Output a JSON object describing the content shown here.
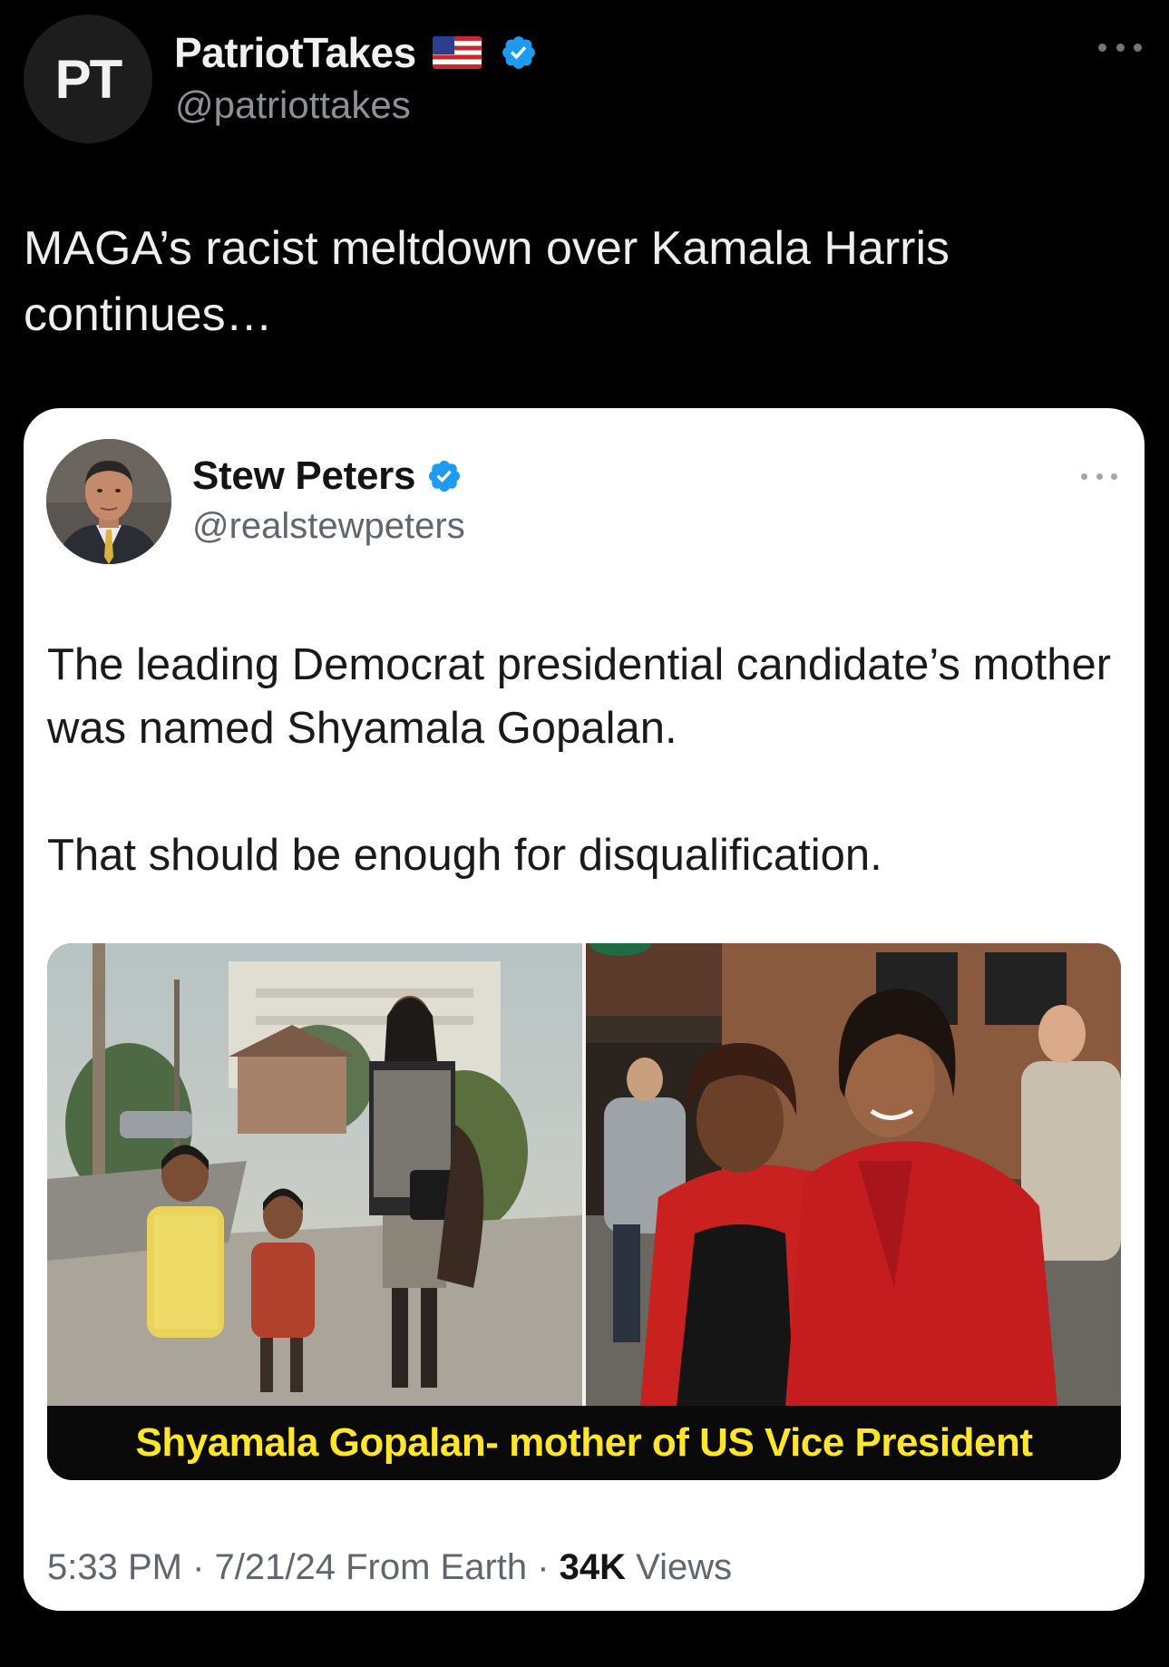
{
  "outer_tweet": {
    "avatar_initials": "PT",
    "author_name": "PatriotTakes",
    "author_handle": "@patriottakes",
    "flag_icon": "us-flag-icon",
    "verified_icon": "verified-badge-icon",
    "body": "MAGA’s racist meltdown over Kamala Harris continues…"
  },
  "quoted_tweet": {
    "author_name": "Stew Peters",
    "author_handle": "@realstewpeters",
    "verified_icon": "verified-badge-icon",
    "paragraph_1": "The leading Democrat presidential candidate’s mother was named Shyamala Gopalan.",
    "paragraph_2": "That should be enough for disqualification.",
    "media_caption": "Shyamala Gopalan- mother of US Vice President",
    "timestamp": "5:33 PM · 7/21/24 From Earth · ",
    "views_count": "34K",
    "views_label": " Views"
  },
  "colors": {
    "background": "#000000",
    "card": "#ffffff",
    "verified_blue": "#1d9bf0",
    "caption_yellow": "#ffe52b"
  }
}
